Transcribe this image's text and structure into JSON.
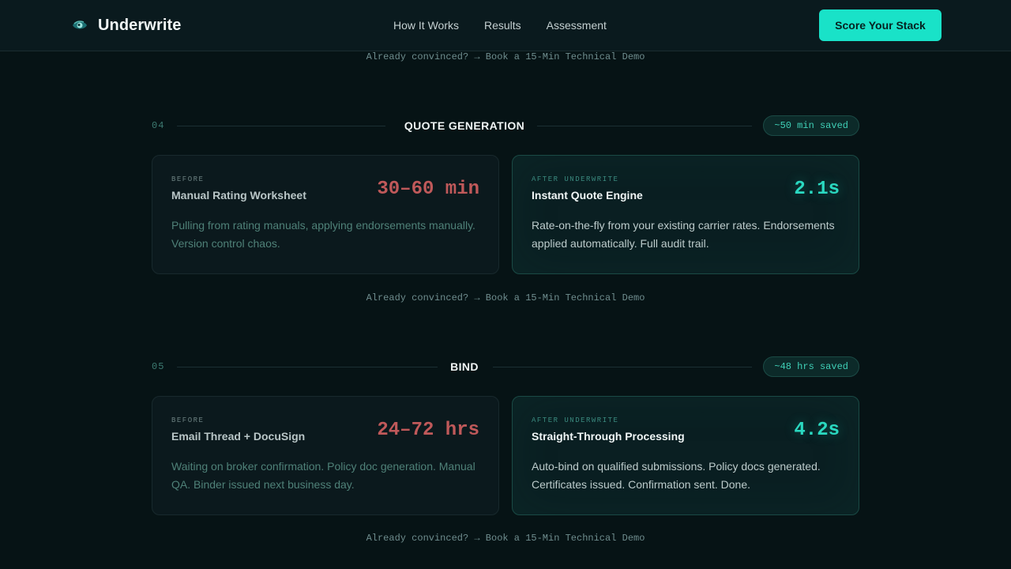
{
  "header": {
    "brand": "Underwrite",
    "nav": [
      "How It Works",
      "Results",
      "Assessment"
    ],
    "cta": "Score Your Stack"
  },
  "demo_link": "Already convinced? → Book a 15-Min Technical Demo",
  "sections": [
    {
      "number": "04",
      "title": "QUOTE GENERATION",
      "saved": "~50 min saved",
      "before": {
        "tag": "BEFORE",
        "title": "Manual Rating Worksheet",
        "metric": "30–60 min",
        "desc": "Pulling from rating manuals, applying endorsements manually. Version control chaos."
      },
      "after": {
        "tag": "AFTER UNDERWRITE",
        "title": "Instant Quote Engine",
        "metric": "2.1s",
        "desc": "Rate-on-the-fly from your existing carrier rates. Endorsements applied automatically. Full audit trail."
      }
    },
    {
      "number": "05",
      "title": "BIND",
      "saved": "~48 hrs saved",
      "before": {
        "tag": "BEFORE",
        "title": "Email Thread + DocuSign",
        "metric": "24–72 hrs",
        "desc": "Waiting on broker confirmation. Policy doc generation. Manual QA. Binder issued next business day."
      },
      "after": {
        "tag": "AFTER UNDERWRITE",
        "title": "Straight-Through Processing",
        "metric": "4.2s",
        "desc": "Auto-bind on qualified submissions. Policy docs generated. Certificates issued. Confirmation sent. Done."
      }
    }
  ],
  "colors": {
    "accent": "#19e2c8",
    "before_metric": "#c0595a",
    "after_metric": "#2ad9c1",
    "background": "#061315"
  },
  "icons": {
    "brand": "eye-logo-icon"
  }
}
